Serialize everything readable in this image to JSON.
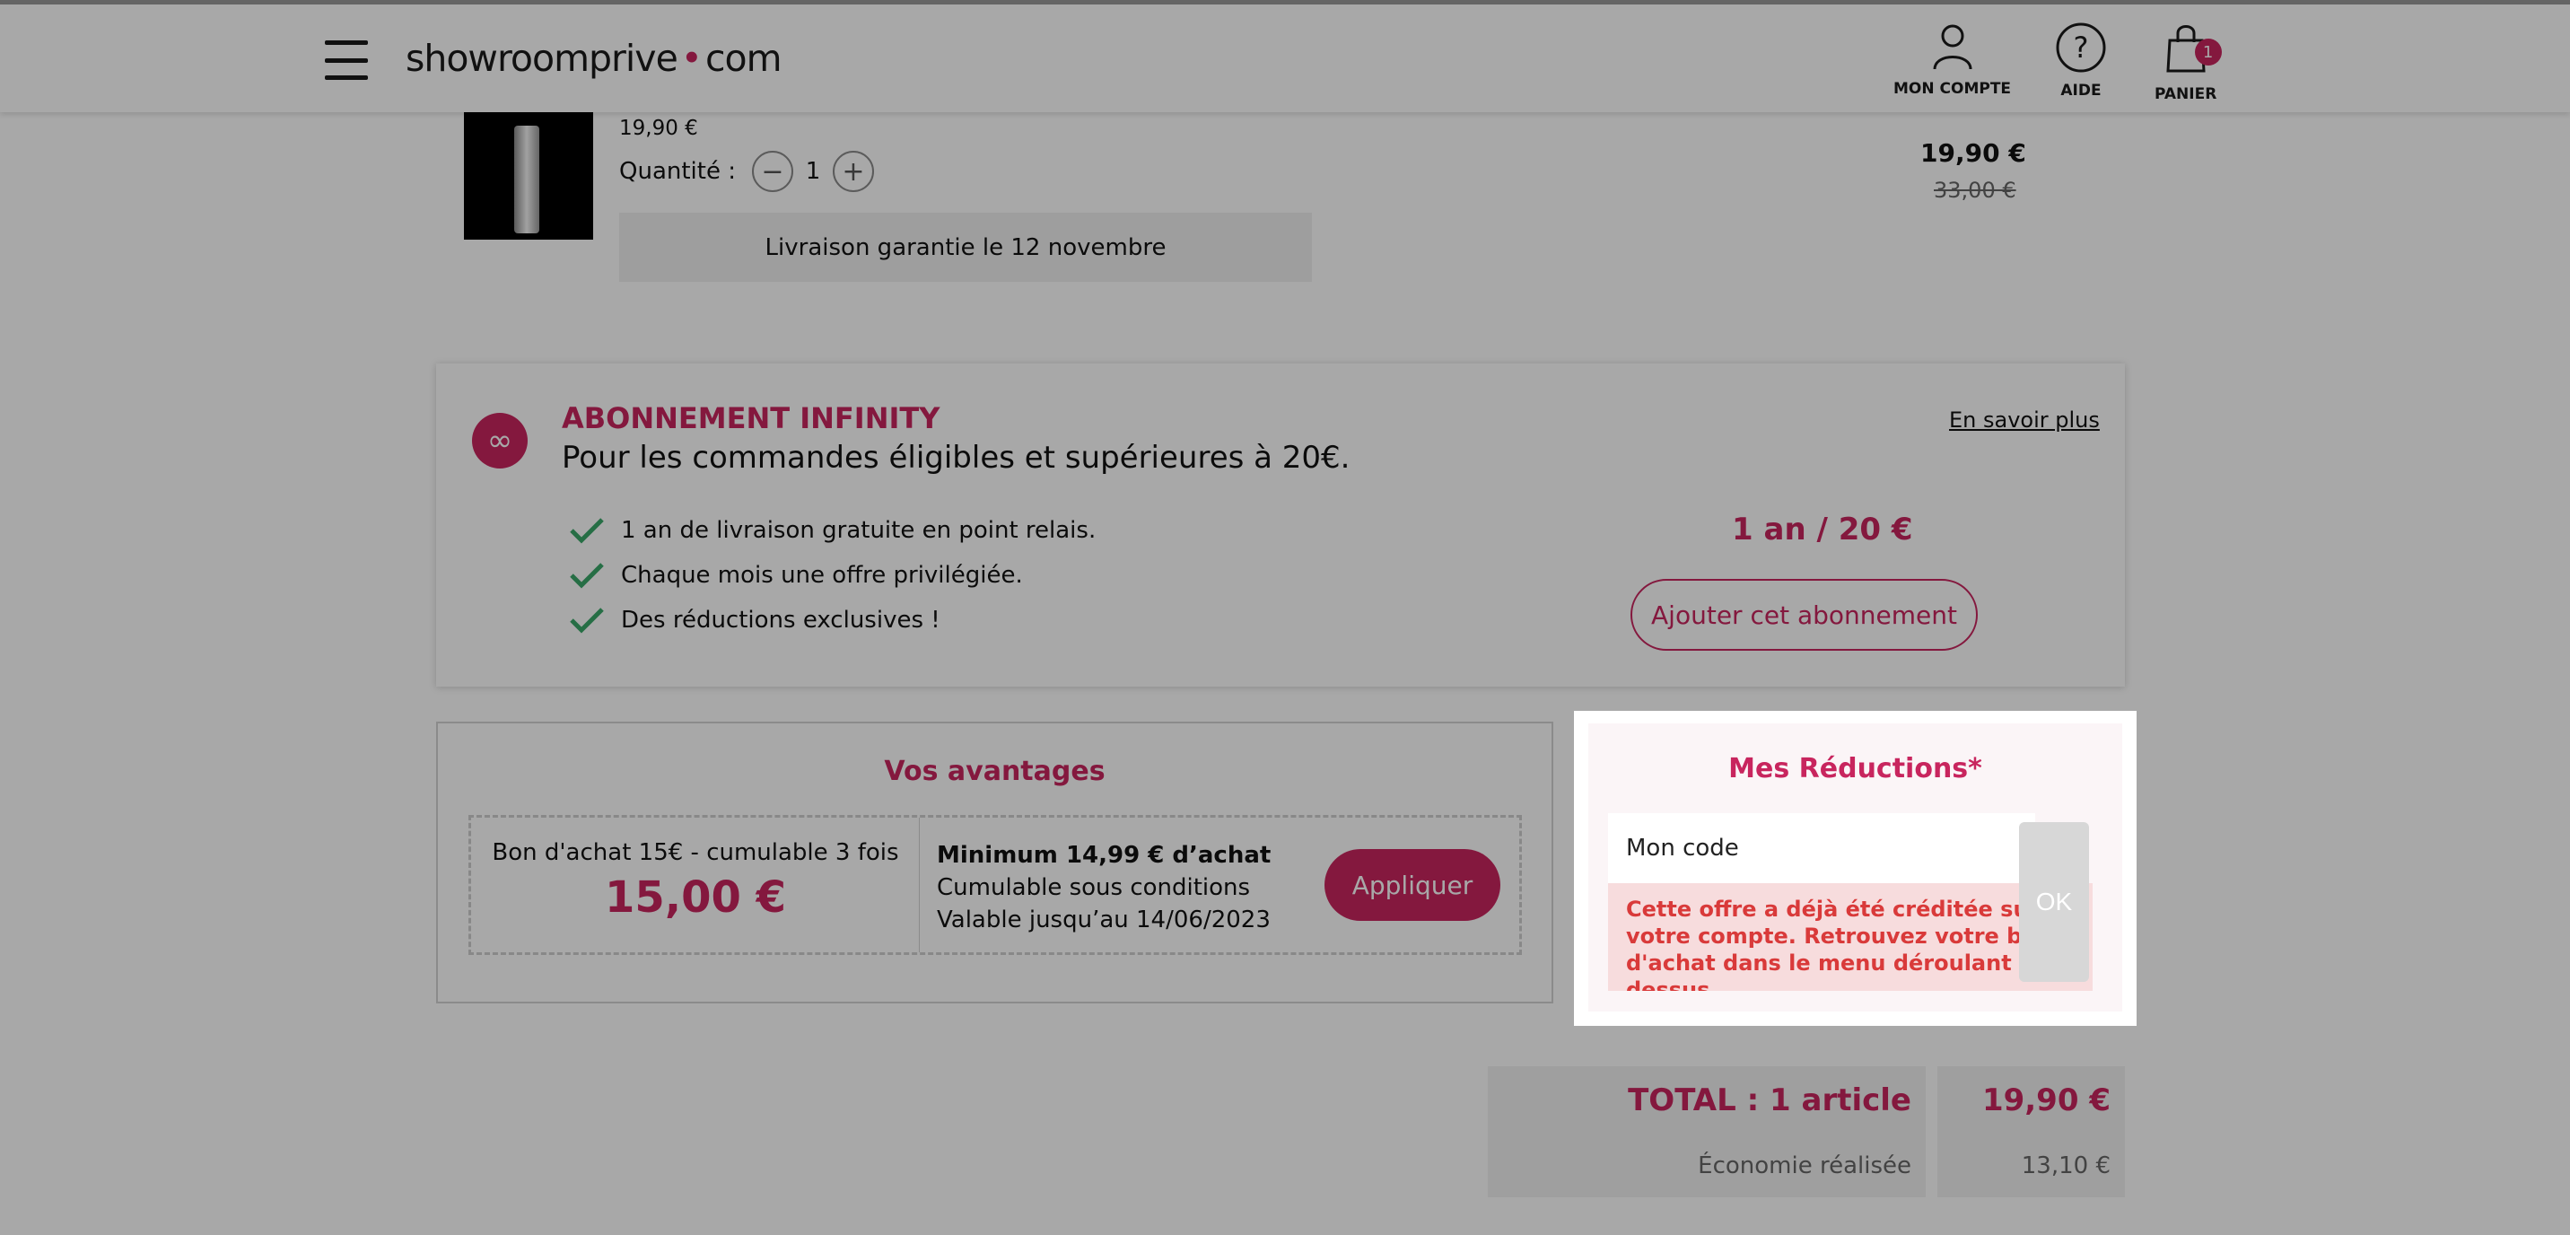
{
  "header": {
    "logo_left": "showroomprive",
    "logo_sep": "•",
    "logo_right": "com",
    "nav": [
      {
        "label": "MON COMPTE",
        "icon": "user-icon"
      },
      {
        "label": "AIDE",
        "icon": "help-icon"
      },
      {
        "label": "PANIER",
        "icon": "bag-icon",
        "badge": "1"
      }
    ]
  },
  "product": {
    "unit_price": "19,90 €",
    "quantity_label": "Quantité :",
    "quantity": "1",
    "delivery": "Livraison garantie le 12 novembre",
    "price": "19,90 €",
    "old_price": "33,00 €"
  },
  "infinity": {
    "title": "ABONNEMENT INFINITY",
    "subtitle": "Pour les commandes éligibles et supérieures à 20€.",
    "more_link": "En savoir plus",
    "benefits": [
      "1 an de livraison gratuite en point relais.",
      "Chaque mois une offre privilégiée.",
      "Des réductions exclusives !"
    ],
    "price": "1 an / 20 €",
    "button": "Ajouter cet abonnement",
    "icon_glyph": "∞"
  },
  "advantages": {
    "title": "Vos avantages",
    "coupon_name": "Bon d'achat 15€ - cumulable 3 fois",
    "coupon_amount": "15,00 €",
    "conditions": [
      "Minimum 14,99 € d’achat",
      "Cumulable sous conditions",
      "Valable jusqu’au 14/06/2023"
    ],
    "apply_button": "Appliquer"
  },
  "totals": {
    "total_label": "TOTAL : 1 article",
    "total_value": "19,90 €",
    "savings_label": "Économie réalisée",
    "savings_value": "13,10 €"
  },
  "reductions": {
    "title": "Mes Réductions*",
    "code_placeholder": "Mon code",
    "ok_button": "OK",
    "error": "Cette offre a déjà été créditée sur votre compte. Retrouvez votre bon d'achat dans le menu déroulant ci-dessus."
  },
  "colors": {
    "brand": "#c8255e",
    "check": "#3aa86a",
    "error_text": "#d93a3a",
    "error_bg": "#f7dcdd"
  }
}
